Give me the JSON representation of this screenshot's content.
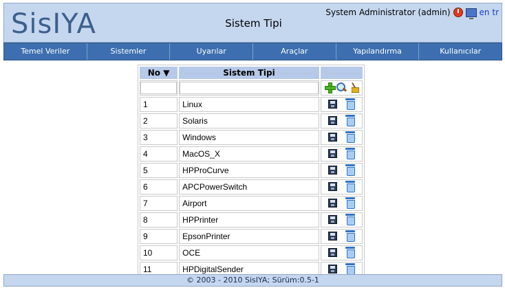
{
  "header": {
    "logo_text": "SisIYA",
    "title": "Sistem Tipi",
    "user": "System Administrator (admin)",
    "lang_en": "en",
    "lang_tr": "tr"
  },
  "menu": [
    {
      "label": "Temel Veriler"
    },
    {
      "label": "Sistemler"
    },
    {
      "label": "Uyarılar"
    },
    {
      "label": "Araçlar"
    },
    {
      "label": "Yapılandırma"
    },
    {
      "label": "Kullanıcılar"
    }
  ],
  "table": {
    "col_no": "No ▼",
    "col_type": "Sistem Tipi",
    "rows": [
      {
        "no": "1",
        "name": "Linux"
      },
      {
        "no": "2",
        "name": "Solaris"
      },
      {
        "no": "3",
        "name": "Windows"
      },
      {
        "no": "4",
        "name": "MacOS_X"
      },
      {
        "no": "5",
        "name": "HPProCurve"
      },
      {
        "no": "6",
        "name": "APCPowerSwitch"
      },
      {
        "no": "7",
        "name": "Airport"
      },
      {
        "no": "8",
        "name": "HPPrinter"
      },
      {
        "no": "9",
        "name": "EpsonPrinter"
      },
      {
        "no": "10",
        "name": "OCE"
      },
      {
        "no": "11",
        "name": "HPDigitalSender"
      }
    ]
  },
  "footer": {
    "text": "© 2003 - 2010 SisIYA; Sürüm:0.5-1"
  },
  "icons": {
    "add": "add-icon",
    "search": "search-icon",
    "clear": "clear-icon",
    "save": "save-icon",
    "delete": "delete-icon",
    "logout": "logout-icon",
    "monitor": "monitor-icon"
  }
}
